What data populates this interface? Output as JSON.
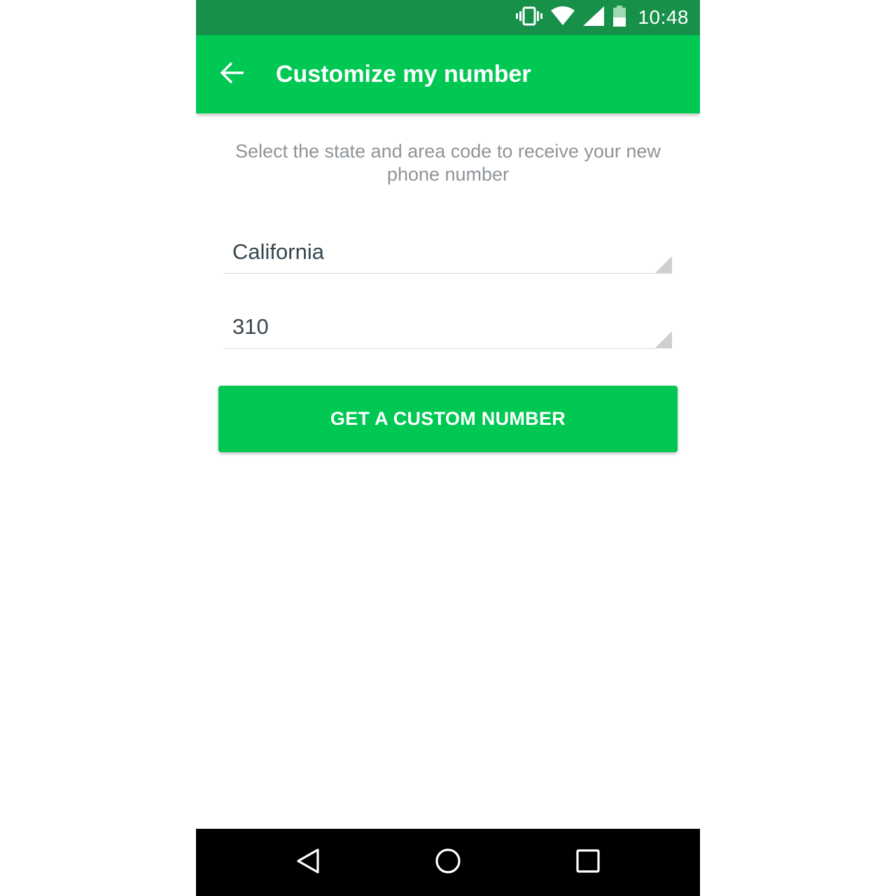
{
  "status_bar": {
    "time": "10:48",
    "icons": [
      "vibrate-icon",
      "wifi-icon",
      "cell-signal-icon",
      "battery-icon"
    ]
  },
  "app_bar": {
    "title": "Customize my number",
    "back_icon": "arrow-back-icon"
  },
  "content": {
    "instruction": "Select the state and area code to receive your new phone number",
    "state_spinner": {
      "value": "California"
    },
    "area_code_spinner": {
      "value": "310"
    },
    "cta_label": "GET A CUSTOM NUMBER"
  },
  "nav_bar": {
    "icons": [
      "nav-back-icon",
      "nav-home-icon",
      "nav-recents-icon"
    ]
  },
  "colors": {
    "status_bar": "#17904a",
    "primary": "#00c853",
    "instruction_text": "#8e9499",
    "field_text": "#37474f",
    "nav_bar": "#000000"
  }
}
